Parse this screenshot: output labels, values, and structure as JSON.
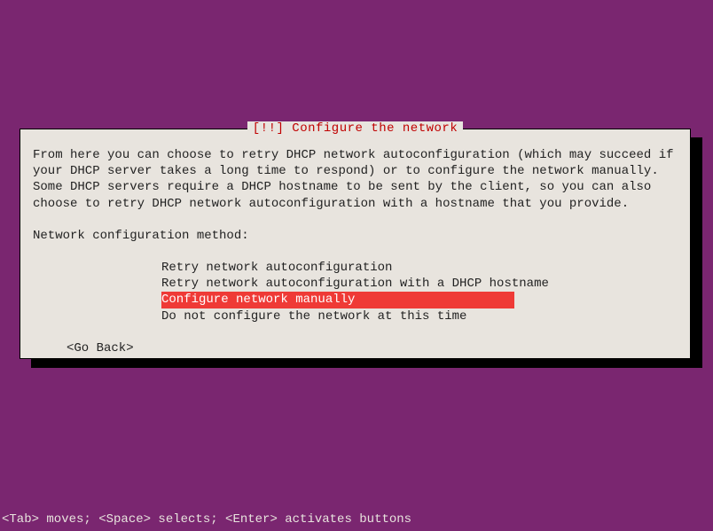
{
  "dialog": {
    "title": "[!!] Configure the network",
    "description": "From here you can choose to retry DHCP network autoconfiguration (which may succeed if your DHCP server takes a long time to respond) or to configure the network manually. Some DHCP servers require a DHCP hostname to be sent by the client, so you can also choose to retry DHCP network autoconfiguration with a hostname that you provide.",
    "prompt": "Network configuration method:",
    "options": [
      "Retry network autoconfiguration",
      "Retry network autoconfiguration with a DHCP hostname",
      "Configure network manually",
      "Do not configure the network at this time"
    ],
    "selected_index": 2,
    "back_button": "<Go Back>"
  },
  "footer": {
    "hint": "<Tab> moves; <Space> selects; <Enter> activates buttons"
  }
}
